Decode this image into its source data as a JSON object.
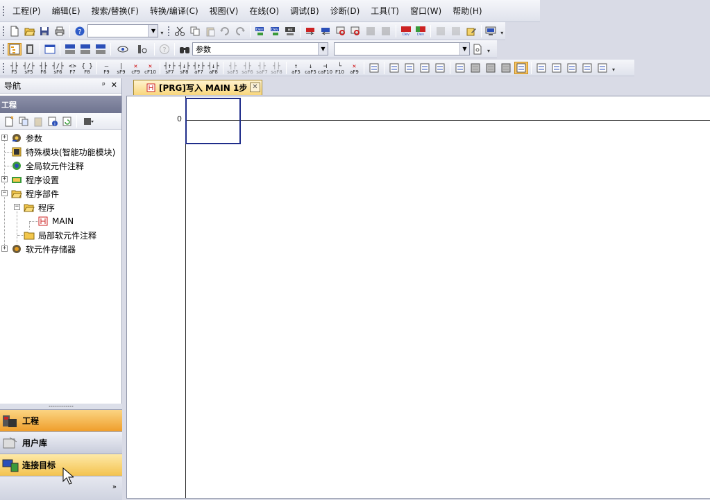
{
  "menu": {
    "items": [
      "工程(P)",
      "编辑(E)",
      "搜索/替换(F)",
      "转换/编译(C)",
      "视图(V)",
      "在线(O)",
      "调试(B)",
      "诊断(D)",
      "工具(T)",
      "窗口(W)",
      "帮助(H)"
    ]
  },
  "toolbar2": {
    "combo_value": "参数"
  },
  "function_keys": [
    {
      "sym": "┤├",
      "key": "F5"
    },
    {
      "sym": "┤/├",
      "key": "sF5"
    },
    {
      "sym": "┤├",
      "key": "F6"
    },
    {
      "sym": "┤/├",
      "key": "sF6"
    },
    {
      "sym": "<>",
      "key": "F7"
    },
    {
      "sym": "{ }",
      "key": "F8"
    },
    {
      "sym": "—",
      "key": "F9"
    },
    {
      "sym": "|",
      "key": "sF9"
    },
    {
      "sym": "✕",
      "key": "cF9",
      "red": true
    },
    {
      "sym": "✕",
      "key": "cF10",
      "red": true
    },
    {
      "sym": "┤↑├",
      "key": "sF7"
    },
    {
      "sym": "┤↓├",
      "key": "sF8"
    },
    {
      "sym": "┤↑├",
      "key": "aF7"
    },
    {
      "sym": "┤↓├",
      "key": "aF8"
    },
    {
      "sym": "┤├",
      "key": "saF5",
      "dim": true
    },
    {
      "sym": "┤├",
      "key": "saF6",
      "dim": true
    },
    {
      "sym": "┤├",
      "key": "saF7",
      "dim": true
    },
    {
      "sym": "┤├",
      "key": "saF8",
      "dim": true
    },
    {
      "sym": "↑",
      "key": "aF5"
    },
    {
      "sym": "↓",
      "key": "caF5"
    },
    {
      "sym": "⊣",
      "key": "caF10"
    },
    {
      "sym": "└",
      "key": "F10"
    },
    {
      "sym": "✕",
      "key": "aF9",
      "red": true
    }
  ],
  "nav": {
    "title": "导航",
    "pin": "ᵖ",
    "close": "✕",
    "section": "工程",
    "tree": [
      {
        "label": "参数",
        "level": 0,
        "expander": "+"
      },
      {
        "label": "特殊模块(智能功能模块)",
        "level": 0,
        "expander": ""
      },
      {
        "label": "全局软元件注释",
        "level": 0,
        "expander": ""
      },
      {
        "label": "程序设置",
        "level": 0,
        "expander": "+"
      },
      {
        "label": "程序部件",
        "level": 0,
        "expander": "−"
      },
      {
        "label": "程序",
        "level": 1,
        "expander": "−"
      },
      {
        "label": "MAIN",
        "level": 2,
        "expander": ""
      },
      {
        "label": "局部软元件注释",
        "level": 1,
        "expander": ""
      },
      {
        "label": "软元件存储器",
        "level": 0,
        "expander": "+"
      }
    ],
    "buttons": {
      "project": "工程",
      "library": "用户库",
      "connection": "连接目标"
    },
    "more": "»"
  },
  "document": {
    "tab_title": "[PRG]写入 MAIN 1步",
    "step_number": "0"
  },
  "colors": {
    "accent": "#f6c465",
    "cursor": "#1f2d8a"
  }
}
